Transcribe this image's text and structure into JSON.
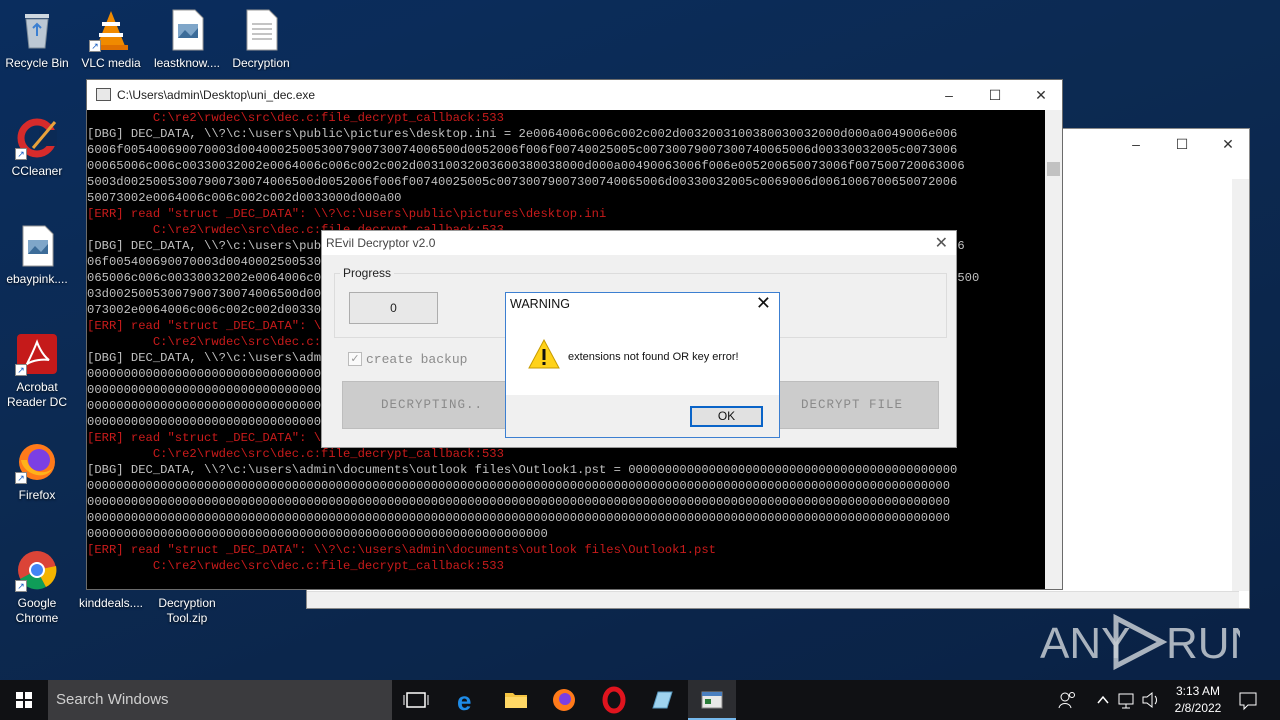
{
  "desktop": {
    "icons": [
      {
        "label": "Recycle Bin",
        "icon": "recycle-bin-icon"
      },
      {
        "label": "VLC media",
        "icon": "vlc-icon"
      },
      {
        "label": "leastknow....",
        "icon": "image-file-icon"
      },
      {
        "label": "Decryption",
        "icon": "text-file-icon"
      },
      {
        "label": "CCleaner",
        "icon": "ccleaner-icon"
      },
      {
        "label": "ebaypink....",
        "icon": "image-file-icon"
      },
      {
        "label": "Acrobat Reader DC",
        "icon": "acrobat-icon"
      },
      {
        "label": "Firefox",
        "icon": "firefox-icon"
      },
      {
        "label": "Google Chrome",
        "icon": "chrome-icon"
      },
      {
        "label": "kinddeals....",
        "icon": "file-icon"
      },
      {
        "label": "Decryption Tool.zip",
        "icon": "zip-icon"
      }
    ]
  },
  "console": {
    "title": "C:\\Users\\admin\\Desktop\\uni_dec.exe",
    "lines": [
      {
        "type": "err",
        "text": "         C:\\re2\\rwdec\\src\\dec.c:file_decrypt_callback:533"
      },
      {
        "type": "dbg",
        "text": "[DBG] DEC_DATA, \\\\?\\c:\\users\\public\\pictures\\desktop.ini = 2e0064006c006c002c002d0032003100380030032000d000a0049006e006"
      },
      {
        "type": "dbg",
        "text": "6006f005400690070003d004000250053007900730074006500d0052006f006f00740025005c00730079007300740065006d00330032005c0073006"
      },
      {
        "type": "dbg",
        "text": "00065006c006c00330032002e0064006c006c002c002d00310032003600380038000d000a00490063006f006e005200650073006f007500720063006"
      },
      {
        "type": "dbg",
        "text": "5003d00250053007900730074006500d0052006f006f00740025005c00730079007300740065006d00330032005c0069006d0061006700650072006"
      },
      {
        "type": "dbg",
        "text": "50073002e0064006c006c002c002d0033000d000a00"
      },
      {
        "type": "err",
        "text": "[ERR] read \"struct _DEC_DATA\": \\\\?\\c:\\users\\public\\pictures\\desktop.ini"
      },
      {
        "type": "err",
        "text": "         C:\\re2\\rwdec\\src\\dec.c:file_decrypt_callback:533"
      },
      {
        "type": "dbg",
        "text": "[DBG] DEC_DATA, \\\\?\\c:\\users\\public\\pictures\\desktop.ini = 2e0064006c006c002c002d0032003100380030032000d000a0049006e0066"
      },
      {
        "type": "dbg",
        "text": "06f005400690070003d004000250053007900730074006500d0052006f006f00740025005c00730079007300740065006d00330032005c007300680"
      },
      {
        "type": "dbg",
        "text": "065006c006c00330032002e0064006c006c002c002d00310032003600380038000d000a00490063006f006e0052006500730006f007500720063006500"
      },
      {
        "type": "dbg",
        "text": "03d00250053007900730074006500d0052006f006f00740025005c00730079007300740065006d00330032005c0069006d006100670065007200650"
      },
      {
        "type": "dbg",
        "text": "073002e0064006c006c002c002d0033000d000a00"
      },
      {
        "type": "err",
        "text": "[ERR] read \"struct _DEC_DATA\": \\\\?\\c:\\users\\public\\pictures\\desktop.ini"
      },
      {
        "type": "err",
        "text": "         C:\\re2\\rwdec\\src\\dec.c:file_decrypt_callback:533"
      },
      {
        "type": "dbg",
        "text": "[DBG] DEC_DATA, \\\\?\\c:\\users\\admin\\documents\\outlook files\\Outlook1.pst = 000000000000000000000000000000000000000000000"
      },
      {
        "type": "dbg",
        "text": "0000000000000000000000000000000000000000000000000000000000000000000000000000000000000000000000000000000000000000000000"
      },
      {
        "type": "dbg",
        "text": "0000000000000000000000000000000000000000000000000000000000000000000000000000000000000000000000000000000000000000000000"
      },
      {
        "type": "dbg",
        "text": "0000000000000000000000000000000000000000000000000000000000000000000000000000000000000000000000000000000000000000000000"
      },
      {
        "type": "dbg",
        "text": "000000000000000000000000000000000000000000000"
      },
      {
        "type": "err",
        "text": "[ERR] read \"struct _DEC_DATA\": \\\\?\\c:\\users\\admin\\documents\\outlook files\\Outlook1.pst"
      },
      {
        "type": "err",
        "text": "         C:\\re2\\rwdec\\src\\dec.c:file_decrypt_callback:533"
      },
      {
        "type": "dbg",
        "text": "[DBG] DEC_DATA, \\\\?\\c:\\users\\admin\\documents\\outlook files\\Outlook1.pst = 000000000000000000000000000000000000000000000"
      },
      {
        "type": "dbg",
        "text": "0000000000000000000000000000000000000000000000000000000000000000000000000000000000000000000000000000000000000000000000"
      },
      {
        "type": "dbg",
        "text": "0000000000000000000000000000000000000000000000000000000000000000000000000000000000000000000000000000000000000000000000"
      },
      {
        "type": "dbg",
        "text": "0000000000000000000000000000000000000000000000000000000000000000000000000000000000000000000000000000000000000000000000"
      },
      {
        "type": "dbg",
        "text": "000000000000000000000000000000000000000000000000000000000000000"
      },
      {
        "type": "err",
        "text": "[ERR] read \"struct _DEC_DATA\": \\\\?\\c:\\users\\admin\\documents\\outlook files\\Outlook1.pst"
      },
      {
        "type": "err",
        "text": "         C:\\re2\\rwdec\\src\\dec.c:file_decrypt_callback:533"
      }
    ]
  },
  "revil": {
    "title": "REvil Decryptor v2.0",
    "progress_label": "Progress",
    "counter": "0",
    "checkbox_label": "create backup",
    "decrypting_button": "DECRYPTING..",
    "decrypt_file_button": "DECRYPT FILE"
  },
  "warning": {
    "title": "WARNING",
    "message": "extensions not found OR key error!",
    "ok_label": "OK"
  },
  "taskbar": {
    "search_placeholder": "Search Windows",
    "time": "3:13 AM",
    "date": "2/8/2022"
  },
  "watermark": {
    "text": "ANY RUN"
  },
  "colors": {
    "err": "#c91b1b",
    "console_text": "#c0c0c0",
    "accent": "#0a64c8"
  }
}
